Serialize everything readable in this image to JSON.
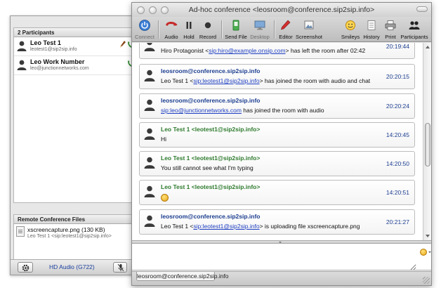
{
  "participants_panel": {
    "header": "2 Participants",
    "items": [
      {
        "name": "Leo Test 1",
        "address": "leotest1@sip2sip.info"
      },
      {
        "name": "Leo Work Number",
        "address": "leo@junctionnetworks.com"
      }
    ]
  },
  "files_panel": {
    "header": "Remote Conference Files",
    "items": [
      {
        "name": "xscreencapture.png (130 KB)",
        "sender": "Leo Test 1 <sip:leotest1@sip2sip.info>"
      }
    ]
  },
  "left_bottom": {
    "audio_label": "HD Audio (G722)"
  },
  "window": {
    "title": "Ad-hoc conference <leosroom@conference.sip2sip.info>"
  },
  "toolbar": {
    "connect": "Connect",
    "audio": "Audio",
    "hold": "Hold",
    "record": "Record",
    "send_file": "Send File",
    "desktop": "Desktop",
    "editor": "Editor",
    "screenshot": "Screenshot",
    "smileys": "Smileys",
    "history": "History",
    "print": "Print",
    "participants": "Participants"
  },
  "messages": [
    {
      "sender": "",
      "text": {
        "pre": "Hiro Protagonist <",
        "link": "sip:hiro@example.onsip.com",
        "post": "> has left the room after 02:42"
      },
      "time": "20:19:44",
      "color": "blue"
    },
    {
      "sender": "leosroom@conference.sip2sip.info",
      "text": {
        "pre": "Leo Test 1 <",
        "link": "sip:leotest1@sip2sip.info",
        "post": "> has joined the room with audio and chat"
      },
      "time": "20:20:15",
      "color": "blue"
    },
    {
      "sender": "leosroom@conference.sip2sip.info",
      "text": {
        "pre": "",
        "link": "sip:leo@junctionnetworks.com",
        "post": " has joined the room with audio"
      },
      "time": "20:20:24",
      "color": "blue"
    },
    {
      "sender": "Leo Test 1 <leotest1@sip2sip.info>",
      "text": {
        "pre": "Hi",
        "link": "",
        "post": ""
      },
      "time": "14:20:45",
      "color": "green"
    },
    {
      "sender": "Leo Test 1 <leotest1@sip2sip.info>",
      "text": {
        "pre": "You still cannot see what I'm typing",
        "link": "",
        "post": ""
      },
      "time": "14:20:50",
      "color": "green"
    },
    {
      "sender": "Leo Test 1 <leotest1@sip2sip.info>",
      "text": {
        "pre": "",
        "link": "",
        "post": ""
      },
      "time": "14:20:51",
      "color": "green",
      "smiley": true
    },
    {
      "sender": "leosroom@conference.sip2sip.info",
      "text": {
        "pre": "Leo Test 1 <",
        "link": "sip:leotest1@sip2sip.info",
        "post": "> is uploading file xscreencapture.png"
      },
      "time": "20:21:27",
      "color": "blue"
    }
  ],
  "tabs": [
    {
      "label": "leosroom@conference.sip2sip.info"
    }
  ],
  "colors": {
    "sender_blue": "#1b3d8f",
    "sender_green": "#2e7b2e",
    "link": "#1f3fc0"
  }
}
